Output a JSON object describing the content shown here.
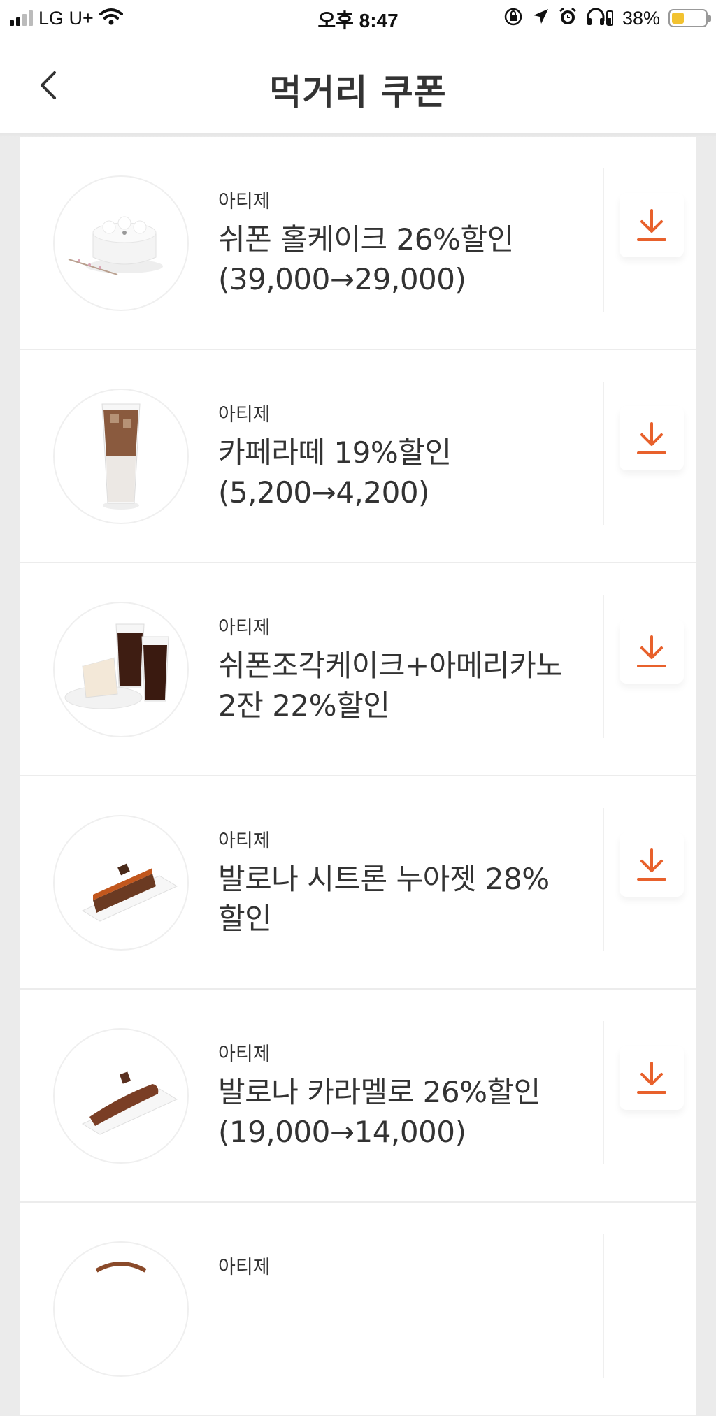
{
  "status_bar": {
    "carrier": "LG U+",
    "time": "오후 8:47",
    "battery_percent_label": "38%",
    "battery_level": 0.38
  },
  "header": {
    "title": "먹거리 쿠폰",
    "back_icon": "chevron-left-icon"
  },
  "colors": {
    "accent": "#e8612c",
    "battery": "#f2c230"
  },
  "coupons": [
    {
      "brand": "아티제",
      "line1": "쉬폰 홀케이크 26%할인",
      "line2": "(39,000→29,000)",
      "image": "chiffon-whole-cake",
      "action_icon": "download-icon"
    },
    {
      "brand": "아티제",
      "line1": "카페라떼 19%할인",
      "line2": "(5,200→4,200)",
      "image": "iced-cafe-latte",
      "action_icon": "download-icon"
    },
    {
      "brand": "아티제",
      "line1": "쉬폰조각케이크+아메리카노",
      "line2": "2잔 22%할인",
      "image": "cake-slice-and-americanos",
      "action_icon": "download-icon"
    },
    {
      "brand": "아티제",
      "line1": "발로나 시트론 누아젯 28%",
      "line2": "할인",
      "image": "valrhona-citron-cake",
      "action_icon": "download-icon"
    },
    {
      "brand": "아티제",
      "line1": "발로나 카라멜로 26%할인",
      "line2": "(19,000→14,000)",
      "image": "valrhona-caramelo-cake",
      "action_icon": "download-icon"
    },
    {
      "brand": "아티제",
      "line1": "",
      "line2": "",
      "image": "",
      "action_icon": "download-icon"
    }
  ]
}
